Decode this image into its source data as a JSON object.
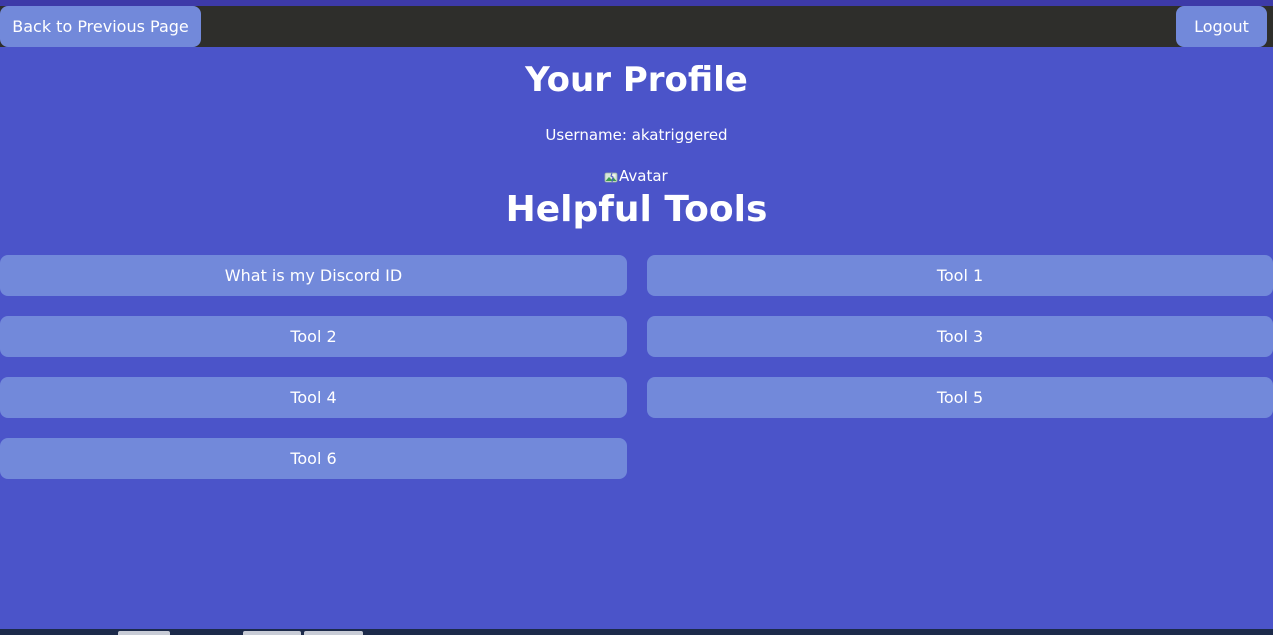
{
  "nav": {
    "back_label": "Back to Previous Page",
    "logout_label": "Logout"
  },
  "profile": {
    "title": "Your Profile",
    "username_line": "Username: akatriggered",
    "avatar_alt": "Avatar",
    "avatar_icon": "broken-image-icon"
  },
  "tools": {
    "title": "Helpful Tools",
    "items": [
      {
        "label": "What is my Discord ID"
      },
      {
        "label": "Tool 1"
      },
      {
        "label": "Tool 2"
      },
      {
        "label": "Tool 3"
      },
      {
        "label": "Tool 4"
      },
      {
        "label": "Tool 5"
      },
      {
        "label": "Tool 6"
      }
    ]
  },
  "colors": {
    "background": "#4b54c9",
    "navbar": "#2e2e2b",
    "button": "#7289da",
    "text": "#ffffff"
  }
}
